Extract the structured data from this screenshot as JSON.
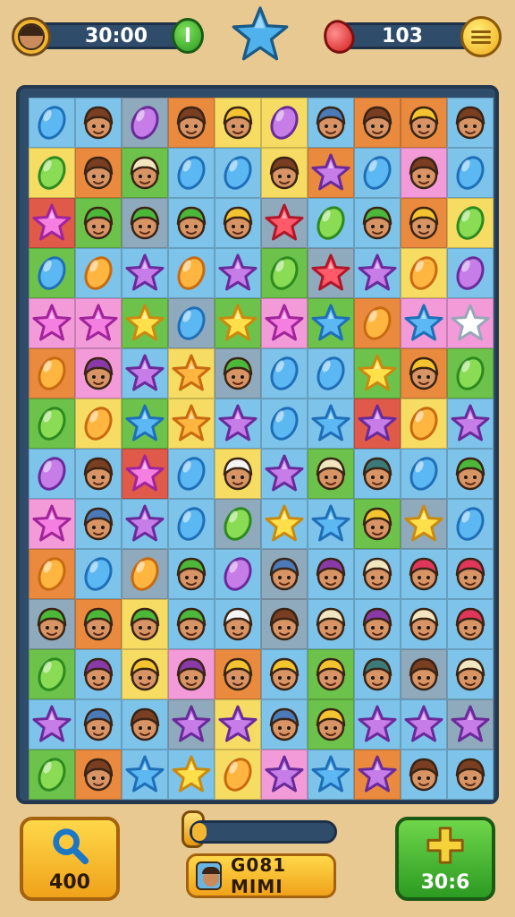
{
  "hud": {
    "timer": "30:00",
    "lives_label": "I",
    "gems": "103"
  },
  "colors": {
    "blue": "#7dc3ea",
    "green": "#6cc24a",
    "yellow": "#f6dc63",
    "orange": "#e98a3f",
    "pink": "#f39ad9",
    "gray": "#8fa9bd",
    "red": "#e05a4a",
    "teal": "#8ec9c0"
  },
  "board": {
    "rows": [
      [
        [
          "blue",
          "bean",
          "blue"
        ],
        [
          "blue",
          "face",
          "brown"
        ],
        [
          "gray",
          "bean",
          "purple"
        ],
        [
          "orange",
          "face",
          "brown"
        ],
        [
          "yellow",
          "face",
          "yellow"
        ],
        [
          "yellow",
          "bean",
          "purple"
        ],
        [
          "blue",
          "face",
          "blue"
        ],
        [
          "orange",
          "face",
          "brown"
        ],
        [
          "orange",
          "face",
          "yellow"
        ],
        [
          "blue",
          "face",
          "brown"
        ]
      ],
      [
        [
          "yellow",
          "bean",
          "green"
        ],
        [
          "orange",
          "face",
          "brown"
        ],
        [
          "green",
          "face",
          "cream"
        ],
        [
          "blue",
          "bean",
          "blue"
        ],
        [
          "blue",
          "bean",
          "blue"
        ],
        [
          "yellow",
          "face",
          "brown"
        ],
        [
          "orange",
          "star",
          "purple"
        ],
        [
          "blue",
          "bean",
          "blue"
        ],
        [
          "pink",
          "face",
          "brown"
        ],
        [
          "blue",
          "bean",
          "blue"
        ]
      ],
      [
        [
          "red",
          "star",
          "pink"
        ],
        [
          "green",
          "face",
          "green"
        ],
        [
          "gray",
          "face",
          "green"
        ],
        [
          "blue",
          "face",
          "green"
        ],
        [
          "blue",
          "face",
          "yellow"
        ],
        [
          "gray",
          "star",
          "red"
        ],
        [
          "blue",
          "bean",
          "green"
        ],
        [
          "blue",
          "face",
          "green"
        ],
        [
          "orange",
          "face",
          "yellow"
        ],
        [
          "yellow",
          "bean",
          "green"
        ]
      ],
      [
        [
          "green",
          "bean",
          "blue"
        ],
        [
          "blue",
          "bean",
          "orange"
        ],
        [
          "blue",
          "star",
          "purple"
        ],
        [
          "blue",
          "bean",
          "orange"
        ],
        [
          "blue",
          "star",
          "purple"
        ],
        [
          "green",
          "bean",
          "green"
        ],
        [
          "gray",
          "star",
          "red"
        ],
        [
          "blue",
          "star",
          "purple"
        ],
        [
          "yellow",
          "bean",
          "orange"
        ],
        [
          "blue",
          "bean",
          "purple"
        ]
      ],
      [
        [
          "pink",
          "star",
          "pink"
        ],
        [
          "pink",
          "star",
          "pink"
        ],
        [
          "green",
          "star",
          "yellow"
        ],
        [
          "gray",
          "bean",
          "blue"
        ],
        [
          "green",
          "star",
          "yellow"
        ],
        [
          "pink",
          "star",
          "pink"
        ],
        [
          "green",
          "star",
          "blue"
        ],
        [
          "orange",
          "bean",
          "orange"
        ],
        [
          "pink",
          "star",
          "blue"
        ],
        [
          "pink",
          "star",
          "white"
        ]
      ],
      [
        [
          "orange",
          "bean",
          "orange"
        ],
        [
          "pink",
          "face",
          "purple"
        ],
        [
          "blue",
          "star",
          "purple"
        ],
        [
          "yellow",
          "star",
          "orange"
        ],
        [
          "gray",
          "face",
          "green"
        ],
        [
          "blue",
          "bean",
          "blue"
        ],
        [
          "blue",
          "bean",
          "blue"
        ],
        [
          "green",
          "star",
          "yellow"
        ],
        [
          "orange",
          "face",
          "yellow"
        ],
        [
          "green",
          "bean",
          "green"
        ]
      ],
      [
        [
          "green",
          "bean",
          "green"
        ],
        [
          "yellow",
          "bean",
          "orange"
        ],
        [
          "green",
          "star",
          "blue"
        ],
        [
          "yellow",
          "star",
          "orange"
        ],
        [
          "blue",
          "star",
          "purple"
        ],
        [
          "blue",
          "bean",
          "blue"
        ],
        [
          "blue",
          "star",
          "blue"
        ],
        [
          "red",
          "star",
          "purple"
        ],
        [
          "yellow",
          "bean",
          "orange"
        ],
        [
          "blue",
          "star",
          "purple"
        ]
      ],
      [
        [
          "blue",
          "bean",
          "purple"
        ],
        [
          "blue",
          "face",
          "brown"
        ],
        [
          "red",
          "star",
          "pink"
        ],
        [
          "blue",
          "bean",
          "blue"
        ],
        [
          "yellow",
          "face",
          "white"
        ],
        [
          "blue",
          "star",
          "purple"
        ],
        [
          "green",
          "face",
          "cream"
        ],
        [
          "blue",
          "face",
          "teal"
        ],
        [
          "blue",
          "bean",
          "blue"
        ],
        [
          "blue",
          "face",
          "green"
        ]
      ],
      [
        [
          "pink",
          "star",
          "pink"
        ],
        [
          "blue",
          "face",
          "blue"
        ],
        [
          "blue",
          "star",
          "purple"
        ],
        [
          "blue",
          "bean",
          "blue"
        ],
        [
          "gray",
          "bean",
          "green"
        ],
        [
          "blue",
          "star",
          "yellow"
        ],
        [
          "blue",
          "star",
          "blue"
        ],
        [
          "green",
          "face",
          "yellow"
        ],
        [
          "gray",
          "star",
          "yellow"
        ],
        [
          "blue",
          "bean",
          "blue"
        ]
      ],
      [
        [
          "orange",
          "bean",
          "orange"
        ],
        [
          "blue",
          "bean",
          "blue"
        ],
        [
          "gray",
          "bean",
          "orange"
        ],
        [
          "blue",
          "face",
          "green"
        ],
        [
          "blue",
          "bean",
          "purple"
        ],
        [
          "gray",
          "face",
          "blue"
        ],
        [
          "blue",
          "face",
          "purple"
        ],
        [
          "blue",
          "face",
          "cream"
        ],
        [
          "blue",
          "face",
          "red"
        ],
        [
          "blue",
          "face",
          "red"
        ]
      ],
      [
        [
          "gray",
          "face",
          "green"
        ],
        [
          "orange",
          "face",
          "green"
        ],
        [
          "yellow",
          "face",
          "green"
        ],
        [
          "blue",
          "face",
          "green"
        ],
        [
          "blue",
          "face",
          "white"
        ],
        [
          "gray",
          "face",
          "brown"
        ],
        [
          "blue",
          "face",
          "cream"
        ],
        [
          "blue",
          "face",
          "purple"
        ],
        [
          "blue",
          "face",
          "cream"
        ],
        [
          "blue",
          "face",
          "red"
        ]
      ],
      [
        [
          "green",
          "bean",
          "green"
        ],
        [
          "blue",
          "face",
          "purple"
        ],
        [
          "yellow",
          "face",
          "yellow"
        ],
        [
          "pink",
          "face",
          "purple"
        ],
        [
          "orange",
          "face",
          "yellow"
        ],
        [
          "blue",
          "face",
          "yellow"
        ],
        [
          "green",
          "face",
          "yellow"
        ],
        [
          "blue",
          "face",
          "teal"
        ],
        [
          "gray",
          "face",
          "brown"
        ],
        [
          "blue",
          "face",
          "cream"
        ]
      ],
      [
        [
          "blue",
          "star",
          "purple"
        ],
        [
          "blue",
          "face",
          "blue"
        ],
        [
          "blue",
          "face",
          "brown"
        ],
        [
          "gray",
          "star",
          "purple"
        ],
        [
          "yellow",
          "star",
          "purple"
        ],
        [
          "blue",
          "face",
          "blue"
        ],
        [
          "green",
          "face",
          "yellow"
        ],
        [
          "blue",
          "star",
          "purple"
        ],
        [
          "blue",
          "star",
          "purple"
        ],
        [
          "gray",
          "star",
          "purple"
        ]
      ],
      [
        [
          "green",
          "bean",
          "green"
        ],
        [
          "orange",
          "face",
          "brown"
        ],
        [
          "blue",
          "star",
          "blue"
        ],
        [
          "blue",
          "star",
          "yellow"
        ],
        [
          "yellow",
          "bean",
          "orange"
        ],
        [
          "pink",
          "star",
          "purple"
        ],
        [
          "blue",
          "star",
          "blue"
        ],
        [
          "orange",
          "star",
          "purple"
        ],
        [
          "blue",
          "face",
          "brown"
        ],
        [
          "blue",
          "face",
          "brown"
        ]
      ]
    ]
  },
  "bottom": {
    "search_value": "400",
    "plus_value": "30:6",
    "progress": 0.1,
    "player_name": "G081 MIMI"
  }
}
